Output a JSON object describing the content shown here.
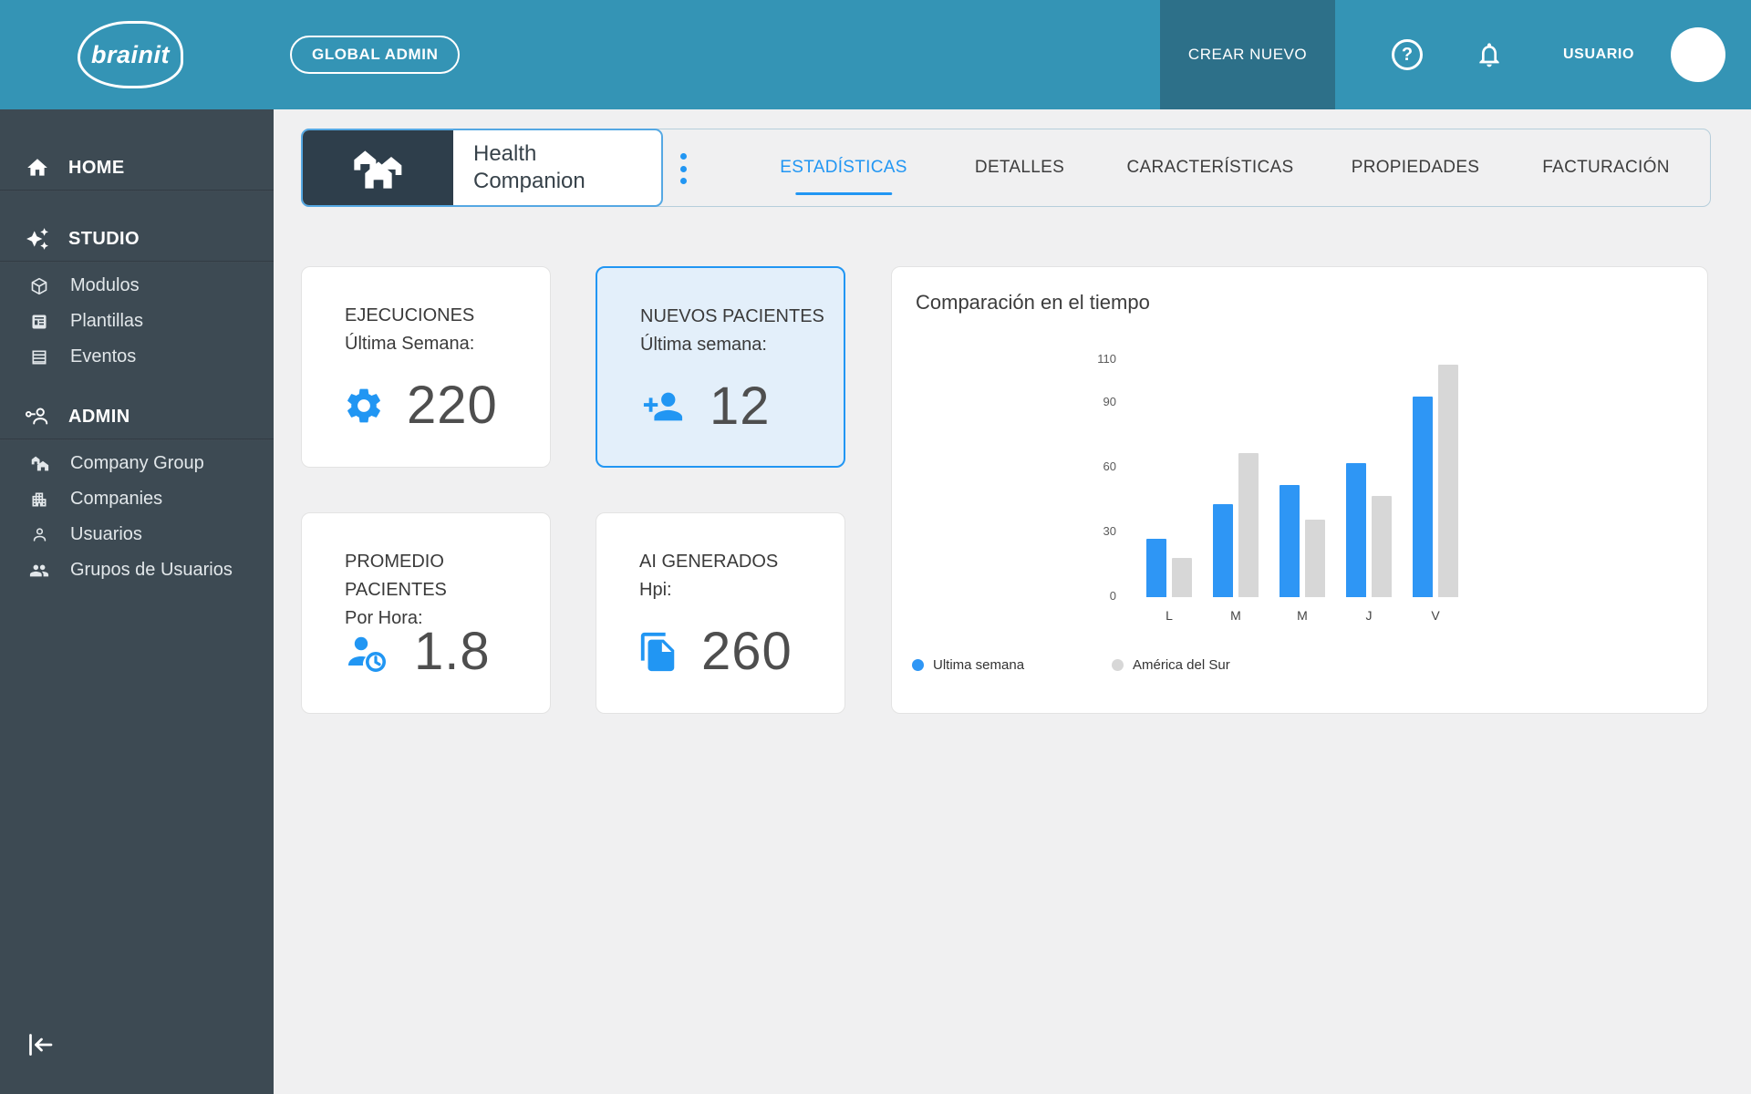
{
  "topbar": {
    "logo": "brainit",
    "badge": "GLOBAL ADMIN",
    "create_button": "CREAR NUEVO",
    "user_label": "USUARIO",
    "help_glyph": "?"
  },
  "sidebar": {
    "items": [
      {
        "label": "HOME",
        "icon": "home-icon",
        "type": "section"
      },
      {
        "label": "STUDIO",
        "icon": "sparkles-icon",
        "type": "section"
      },
      {
        "label": "Modulos",
        "icon": "cube-icon",
        "type": "item"
      },
      {
        "label": "Plantillas",
        "icon": "template-icon",
        "type": "item"
      },
      {
        "label": "Eventos",
        "icon": "events-table-icon",
        "type": "item"
      },
      {
        "label": "ADMIN",
        "icon": "admin-key-person-icon",
        "type": "section"
      },
      {
        "label": "Company Group",
        "icon": "houses-icon",
        "type": "item"
      },
      {
        "label": "Companies",
        "icon": "building-icon",
        "type": "item"
      },
      {
        "label": "Usuarios",
        "icon": "person-icon",
        "type": "item"
      },
      {
        "label": "Grupos de Usuarios",
        "icon": "people-group-icon",
        "type": "item"
      }
    ]
  },
  "header": {
    "product_name": "Health Companion",
    "tabs": [
      {
        "label": "ESTADÍSTICAS",
        "active": true
      },
      {
        "label": "DETALLES",
        "active": false
      },
      {
        "label": "CARACTERÍSTICAS",
        "active": false
      },
      {
        "label": "PROPIEDADES",
        "active": false
      },
      {
        "label": "FACTURACIÓN",
        "active": false
      }
    ]
  },
  "stats": {
    "cards": [
      {
        "title": "EJECUCIONES",
        "subtitle": "Última Semana:",
        "value": "220",
        "icon": "gear-icon",
        "highlighted": false
      },
      {
        "title": "NUEVOS PACIENTES",
        "subtitle": "Última semana:",
        "value": "12",
        "icon": "person-add-icon",
        "highlighted": true
      },
      {
        "title": "PROMEDIO PACIENTES",
        "subtitle": "Por Hora:",
        "value": "1.8",
        "icon": "person-clock-icon",
        "highlighted": false
      },
      {
        "title": "AI GENERADOS",
        "subtitle": "Hpi:",
        "value": "260",
        "icon": "document-copy-icon",
        "highlighted": false
      }
    ]
  },
  "chart_data": {
    "type": "bar",
    "title": "Comparación en el tiempo",
    "categories": [
      "L",
      "M",
      "M",
      "J",
      "V"
    ],
    "series": [
      {
        "name": "Ultima semana",
        "color": "#2e96f5",
        "values": [
          27,
          43,
          52,
          62,
          93
        ]
      },
      {
        "name": "América del Sur",
        "color": "#d7d7d7",
        "values": [
          18,
          67,
          36,
          47,
          108
        ]
      }
    ],
    "y_ticks": [
      0,
      30,
      60,
      90,
      110
    ],
    "ylim": [
      0,
      110
    ],
    "xlabel": "",
    "ylabel": "",
    "grid": false,
    "legend_position": "bottom"
  },
  "colors": {
    "accent": "#2196f3",
    "topbar": "#3494b5",
    "topbar_button": "#2d7089",
    "sidebar": "#3d4a53",
    "bar_blue": "#2e96f5",
    "bar_gray": "#d7d7d7",
    "highlight_card_bg": "#e3effa"
  }
}
